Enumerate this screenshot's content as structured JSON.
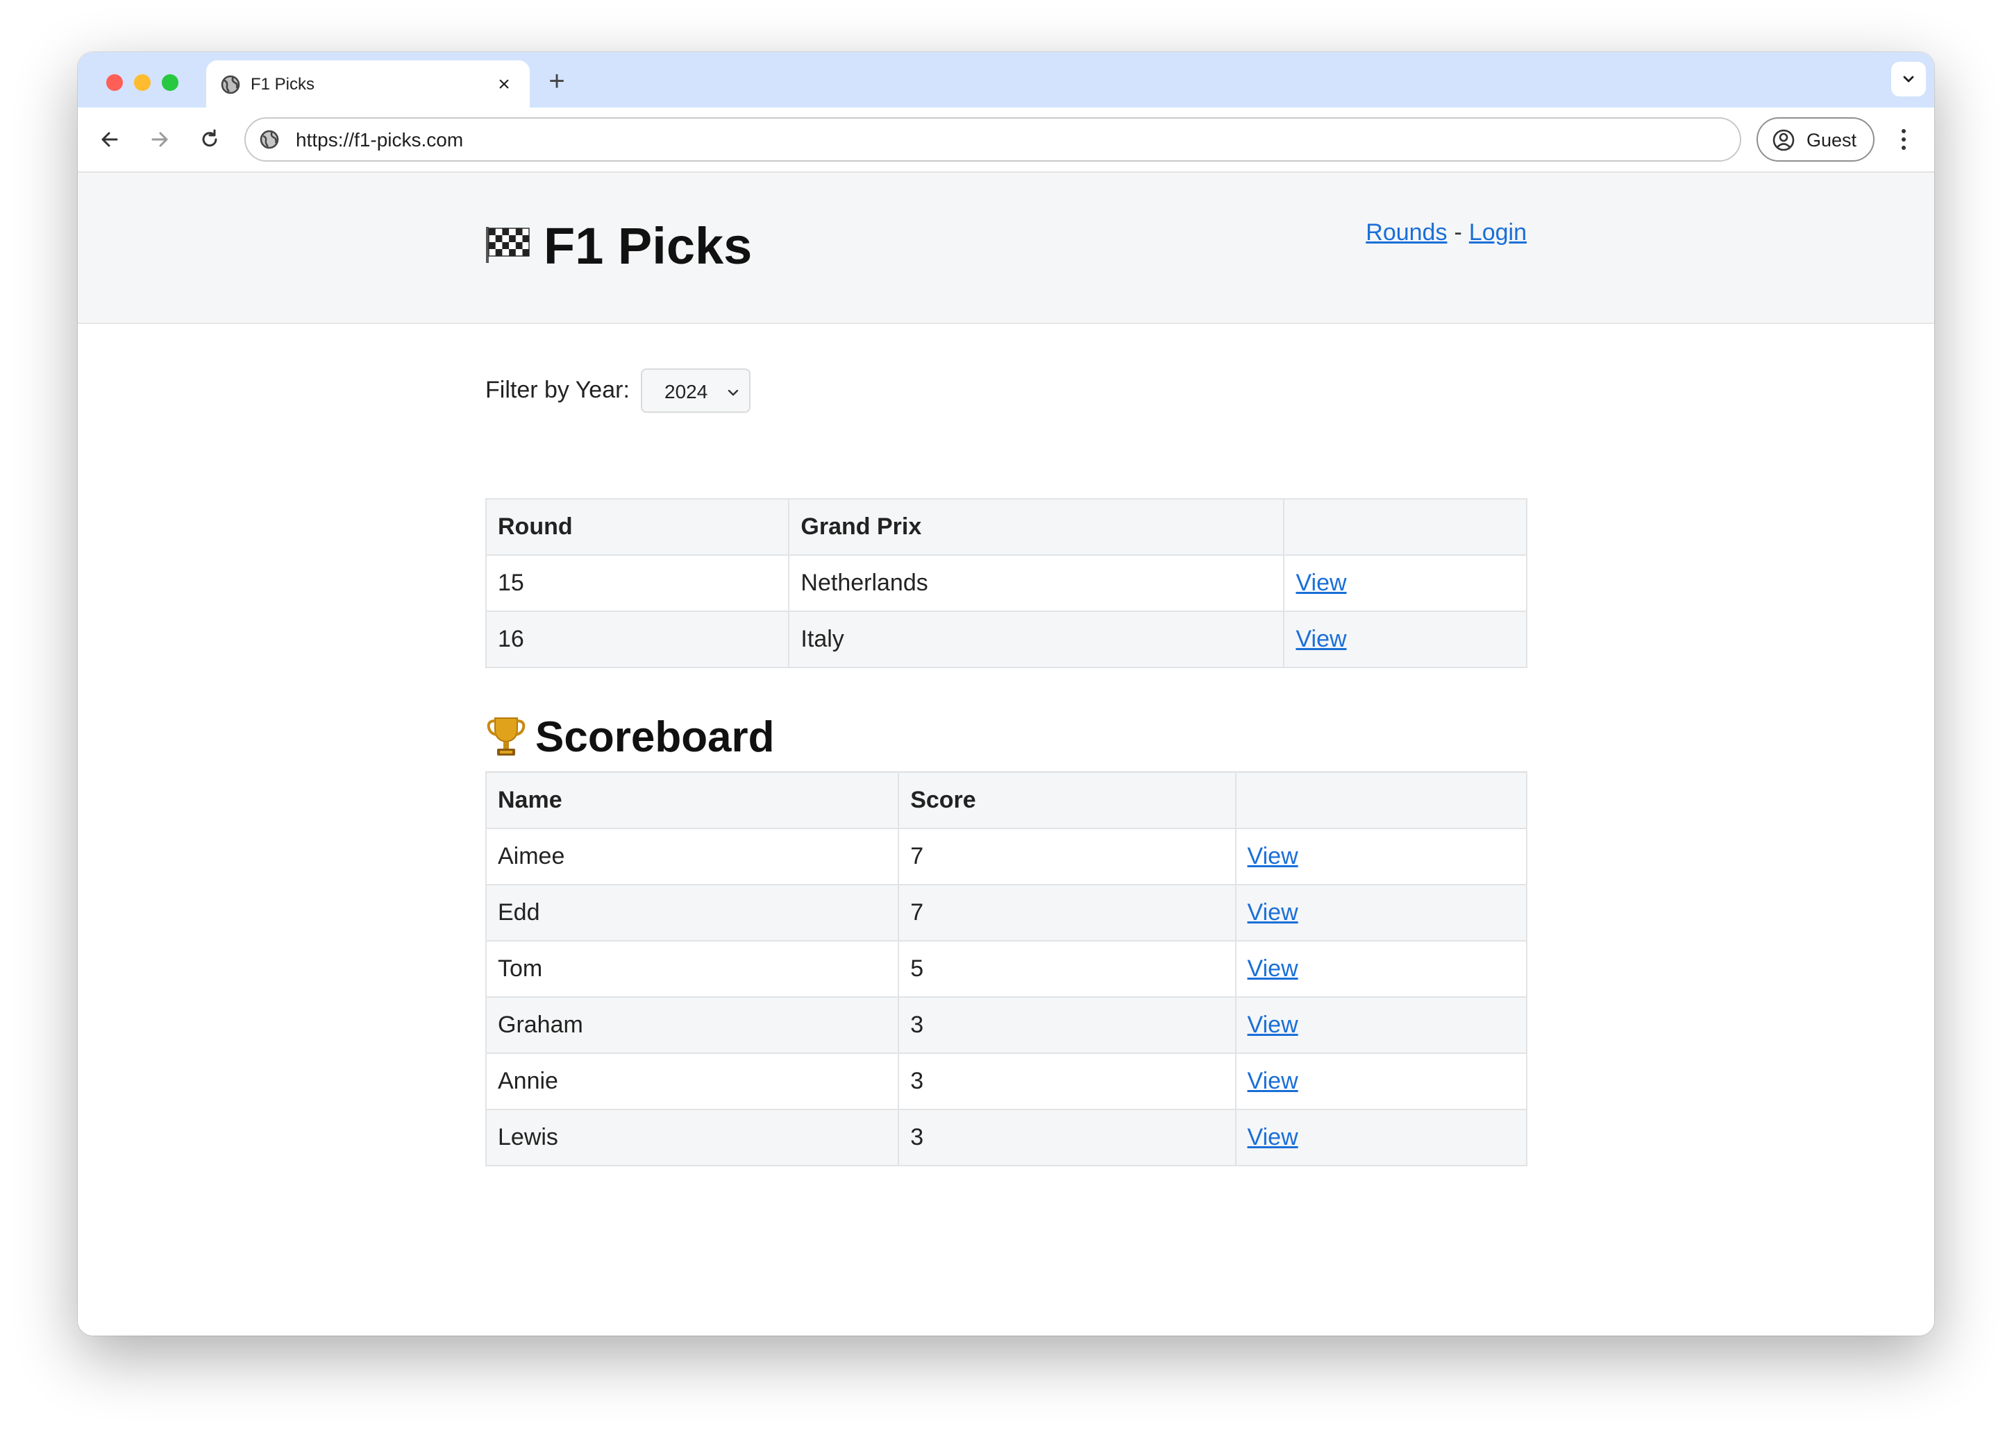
{
  "browser": {
    "tab_title": "F1 Picks",
    "tab_close": "×",
    "new_tab": "+",
    "url": "https://f1-picks.com",
    "profile_label": "Guest"
  },
  "site": {
    "title": "F1 Picks",
    "nav": {
      "rounds": "Rounds",
      "separator": "-",
      "login": "Login"
    }
  },
  "filter": {
    "label": "Filter by Year:",
    "selected_year": "2024"
  },
  "rounds": {
    "headers": [
      "Round",
      "Grand Prix",
      ""
    ],
    "rows": [
      {
        "round": "15",
        "grand_prix": "Netherlands",
        "action": "View"
      },
      {
        "round": "16",
        "grand_prix": "Italy",
        "action": "View"
      }
    ]
  },
  "scoreboard": {
    "title": "Scoreboard",
    "headers": [
      "Name",
      "Score",
      ""
    ],
    "rows": [
      {
        "name": "Aimee",
        "score": "7",
        "action": "View"
      },
      {
        "name": "Edd",
        "score": "7",
        "action": "View"
      },
      {
        "name": "Tom",
        "score": "5",
        "action": "View"
      },
      {
        "name": "Graham",
        "score": "3",
        "action": "View"
      },
      {
        "name": "Annie",
        "score": "3",
        "action": "View"
      },
      {
        "name": "Lewis",
        "score": "3",
        "action": "View"
      }
    ]
  },
  "icons": {
    "tab_favicon": "globe-icon",
    "site_info": "site-info-icon",
    "brand": "checkered-flag-icon",
    "scoreboard": "trophy-icon",
    "profile": "person-circle-icon"
  },
  "colors": {
    "tab_strip": "#d3e3fd",
    "link": "#1a6fd8",
    "header_bg": "#f5f6f7"
  }
}
